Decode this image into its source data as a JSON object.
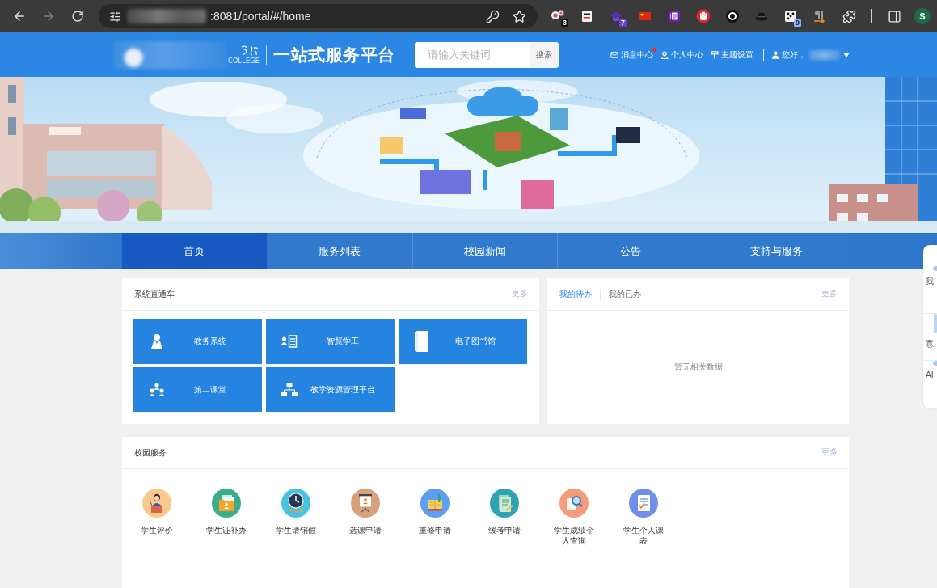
{
  "browser": {
    "url": ":8081/portal/#/home",
    "extensions": [
      {
        "kind": "bubbles",
        "badge": "3"
      },
      {
        "kind": "reader"
      },
      {
        "kind": "cap",
        "badge": "7"
      },
      {
        "kind": "flag"
      },
      {
        "kind": "notebook"
      },
      {
        "kind": "stop"
      },
      {
        "kind": "ring"
      },
      {
        "kind": "hat"
      },
      {
        "kind": "dice",
        "badge": "9"
      },
      {
        "kind": "paragraph"
      },
      {
        "kind": "puzzle"
      }
    ],
    "profile_initial": "S"
  },
  "header": {
    "logo_caption": "COLLEGE",
    "title": "一站式服务平台",
    "search": {
      "placeholder": "请输入关键词",
      "button": "搜索"
    },
    "links": [
      {
        "kind": "mail",
        "label": "消息中心",
        "unread": true
      },
      {
        "kind": "person",
        "label": "个人中心",
        "unread": false
      },
      {
        "kind": "roller",
        "label": "主题设置",
        "unread": false
      }
    ],
    "greeting": "您好，"
  },
  "nav": [
    {
      "label": "首页",
      "selected": true
    },
    {
      "label": "服务列表",
      "selected": false
    },
    {
      "label": "校园新闻",
      "selected": false
    },
    {
      "label": "公告",
      "selected": false
    },
    {
      "label": "支持与服务",
      "selected": false
    }
  ],
  "system_card": {
    "title": "系统直通车",
    "more": "更多",
    "tiles": [
      {
        "kind": "person",
        "label": "教务系统"
      },
      {
        "kind": "roster",
        "label": "智慧学工"
      },
      {
        "kind": "book",
        "label": "电子图书馆"
      },
      {
        "kind": "group",
        "label": "第二课堂"
      },
      {
        "kind": "network",
        "label": "教学资源管理平台"
      }
    ]
  },
  "todo_card": {
    "tabs": [
      {
        "label": "我的待办",
        "selected": true
      },
      {
        "label": "我的已办",
        "selected": false
      }
    ],
    "more": "更多",
    "empty_text": "暂无相关数据"
  },
  "services_card": {
    "title": "校园服务",
    "more": "更多",
    "items": [
      {
        "kind": "lecturer",
        "label": "学生评价",
        "color": "#fbc88e"
      },
      {
        "kind": "folder",
        "label": "学生证补办",
        "color": "#3aad8b"
      },
      {
        "kind": "clock",
        "label": "学生请销假",
        "color": "#46c3e0"
      },
      {
        "kind": "board",
        "label": "选课申请",
        "color": "#d8a07c"
      },
      {
        "kind": "book",
        "label": "重修申请",
        "color": "#5c9ff0"
      },
      {
        "kind": "document",
        "label": "缓考申请",
        "color": "#2fa3b6"
      },
      {
        "kind": "search",
        "label": "学生成绩个人查询",
        "color": "#f49b78"
      },
      {
        "kind": "schedule",
        "label": "学生个人课表",
        "color": "#6f8fe8"
      }
    ]
  },
  "side_panel": {
    "items": [
      {
        "kind": "dot",
        "label": "我"
      },
      {
        "kind": "bar",
        "label": "意"
      },
      {
        "kind": "dot",
        "label": "AI"
      }
    ]
  }
}
